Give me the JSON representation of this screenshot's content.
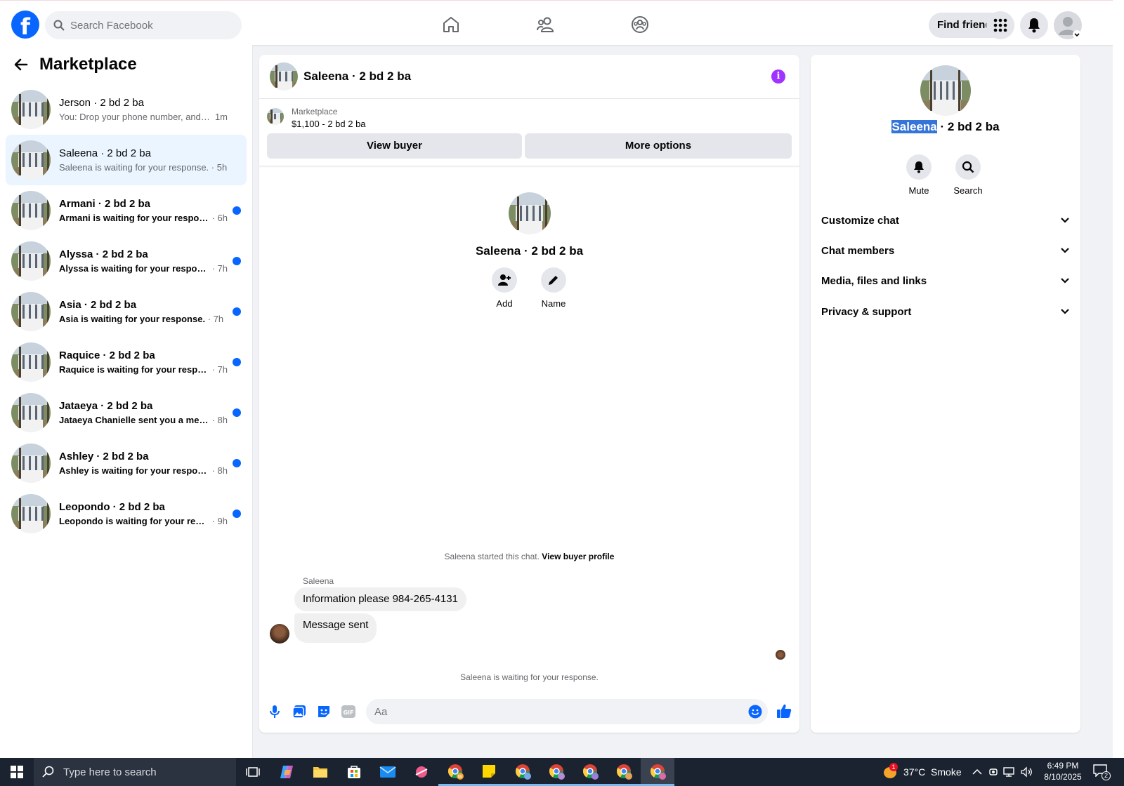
{
  "topbar": {
    "search_placeholder": "Search Facebook",
    "find_friends": "Find friends"
  },
  "sidebar": {
    "title": "Marketplace",
    "conversations": [
      {
        "name": "Jerson · 2 bd 2 ba",
        "preview": "You: Drop your phone number, and w...",
        "time": "1m",
        "unread": false,
        "active": false
      },
      {
        "name": "Saleena · 2 bd 2 ba",
        "preview": "Saleena is waiting for your response.",
        "time": "5h",
        "unread": false,
        "active": true
      },
      {
        "name": "Armani · 2 bd 2 ba",
        "preview": "Armani is waiting for your response.",
        "time": "6h",
        "unread": true,
        "active": false
      },
      {
        "name": "Alyssa · 2 bd 2 ba",
        "preview": "Alyssa is waiting for your response.",
        "time": "7h",
        "unread": true,
        "active": false
      },
      {
        "name": "Asia · 2 bd 2 ba",
        "preview": "Asia is waiting for your response.",
        "time": "7h",
        "unread": true,
        "active": false
      },
      {
        "name": "Raquice · 2 bd 2 ba",
        "preview": "Raquice is waiting for your respon...",
        "time": "7h",
        "unread": true,
        "active": false
      },
      {
        "name": "Jataeya · 2 bd 2 ba",
        "preview": "Jataeya Chanielle sent you a messa...",
        "time": "8h",
        "unread": true,
        "active": false
      },
      {
        "name": "Ashley · 2 bd 2 ba",
        "preview": "Ashley is waiting for your response.",
        "time": "8h",
        "unread": true,
        "active": false
      },
      {
        "name": "Leopondo · 2 bd 2 ba",
        "preview": "Leopondo is waiting for your resp...",
        "time": "9h",
        "unread": true,
        "active": false
      }
    ]
  },
  "chat": {
    "title": "Saleena · 2 bd 2 ba",
    "listing_source": "Marketplace",
    "listing_price": "$1,100 - 2 bd 2 ba",
    "view_buyer": "View buyer",
    "more_options": "More options",
    "profile_name": "Saleena · 2 bd 2 ba",
    "add_label": "Add",
    "name_label": "Name",
    "started_text": "Saleena started this chat.",
    "view_buyer_profile": "View buyer profile",
    "sender": "Saleena",
    "message_1": "Information please 984-265-4131",
    "message_2": "Message sent",
    "waiting_text": "Saleena is waiting for your response.",
    "composer_placeholder": "Aa"
  },
  "info_panel": {
    "name_highlight": "Saleena",
    "name_rest": " · 2 bd 2 ba",
    "mute": "Mute",
    "search": "Search",
    "sections": [
      "Customize chat",
      "Chat members",
      "Media, files and links",
      "Privacy & support"
    ]
  },
  "taskbar": {
    "search_placeholder": "Type here to search",
    "weather": "37°C  Smoke",
    "time": "6:49 PM",
    "date": "8/10/2025",
    "notification_count": "2",
    "weather_badge": "1"
  },
  "colors": {
    "facebook_blue": "#0866ff",
    "unread_dot": "#0866ff",
    "active_bg": "#ebf5ff",
    "info_purple": "#a033ff",
    "selection_highlight": "#3574d8",
    "taskbar": "#1b2330"
  }
}
